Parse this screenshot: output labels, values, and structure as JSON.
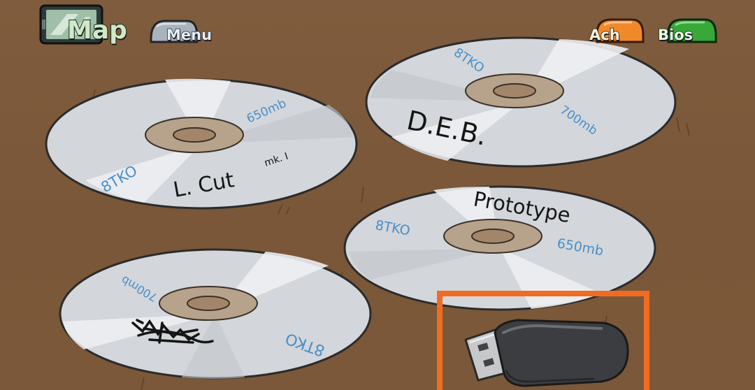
{
  "hud": {
    "map_label": "Map",
    "menu_label": "Menu",
    "ach_label": "Ach",
    "bios_label": "Bios"
  },
  "discs": [
    {
      "title": "L. Cut",
      "title_suffix": "mk. I",
      "brand": "8TKO",
      "capacity": "650mb"
    },
    {
      "title": "D.E.B.",
      "brand": "8TKO",
      "capacity": "700mb"
    },
    {
      "title": "Prototype",
      "brand": "8TKO",
      "capacity": "650mb"
    },
    {
      "title": "",
      "brand": "8TKO",
      "capacity": "700mb"
    }
  ],
  "selection": {
    "item": "usb-drive"
  },
  "colors": {
    "highlight": "#f26b22",
    "table": "#7b5839",
    "disc": "#d3d6da",
    "disc_hub": "#b7a28c",
    "disc_text_blue": "#4a8fc8",
    "map_green": "#cfe9c8",
    "ach_orange": "#f0892a",
    "bios_green": "#38a838",
    "menu_gray": "#a9b2bd"
  }
}
